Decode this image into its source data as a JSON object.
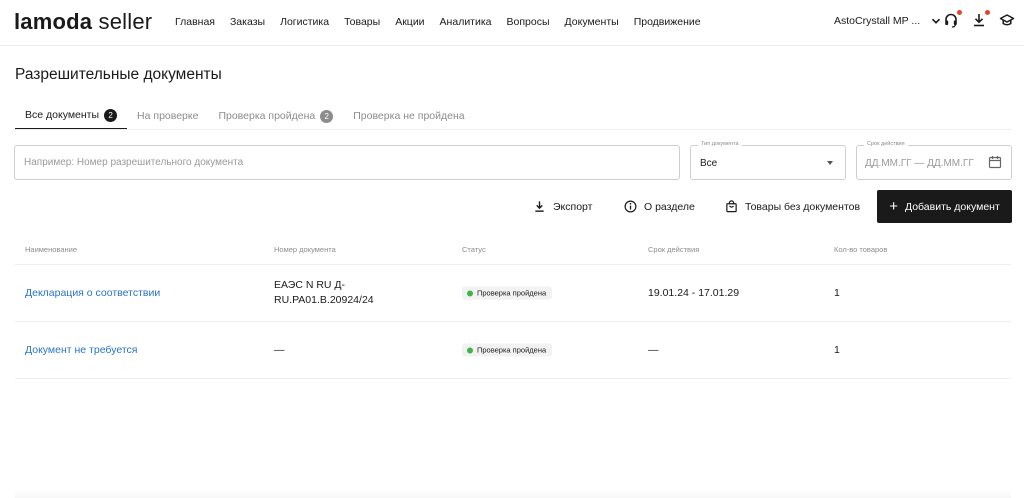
{
  "header": {
    "logo_brand": "lamoda",
    "logo_suffix": "seller",
    "nav": [
      "Главная",
      "Заказы",
      "Логистика",
      "Товары",
      "Акции",
      "Аналитика",
      "Вопросы",
      "Документы",
      "Продвижение"
    ],
    "account_name": "AstoCrystall MP ...",
    "icons": [
      "headset-icon",
      "download-icon",
      "graduation-cap-icon"
    ],
    "notification_color": "#e5432a"
  },
  "page": {
    "title": "Разрешительные документы"
  },
  "tabs": [
    {
      "label": "Все документы",
      "count": "2"
    },
    {
      "label": "На проверке",
      "count": ""
    },
    {
      "label": "Проверка пройдена",
      "count": "2"
    },
    {
      "label": "Проверка не пройдена",
      "count": ""
    }
  ],
  "filters": {
    "search_placeholder": "Например: Номер разрешительного документа",
    "doc_type_label": "Тип документа",
    "doc_type_value": "Все",
    "period_label": "Срок действия",
    "period_placeholder": "ДД.ММ.ГГ — ДД.ММ.ГГ"
  },
  "actions": {
    "export": "Экспорт",
    "about": "О разделе",
    "no_docs": "Товары без документов",
    "add": "Добавить документ"
  },
  "table": {
    "columns": [
      "Наименование",
      "Номер документа",
      "Статус",
      "Срок действия",
      "Кол-во товаров"
    ],
    "rows": [
      {
        "name": "Декларация о соответствии",
        "number_line1": "ЕАЭС N RU Д-",
        "number_line2": "RU.PA01.B.20924/24",
        "status": "Проверка пройдена",
        "period": "19.01.24 - 17.01.29",
        "qty": "1"
      },
      {
        "name": "Документ не требуется",
        "number_line1": "—",
        "number_line2": "",
        "status": "Проверка пройдена",
        "period": "—",
        "qty": "1"
      }
    ]
  },
  "colors": {
    "accent_dark": "#1a1a1a",
    "link": "#2a74c9",
    "status_ok": "#3fb44a"
  }
}
